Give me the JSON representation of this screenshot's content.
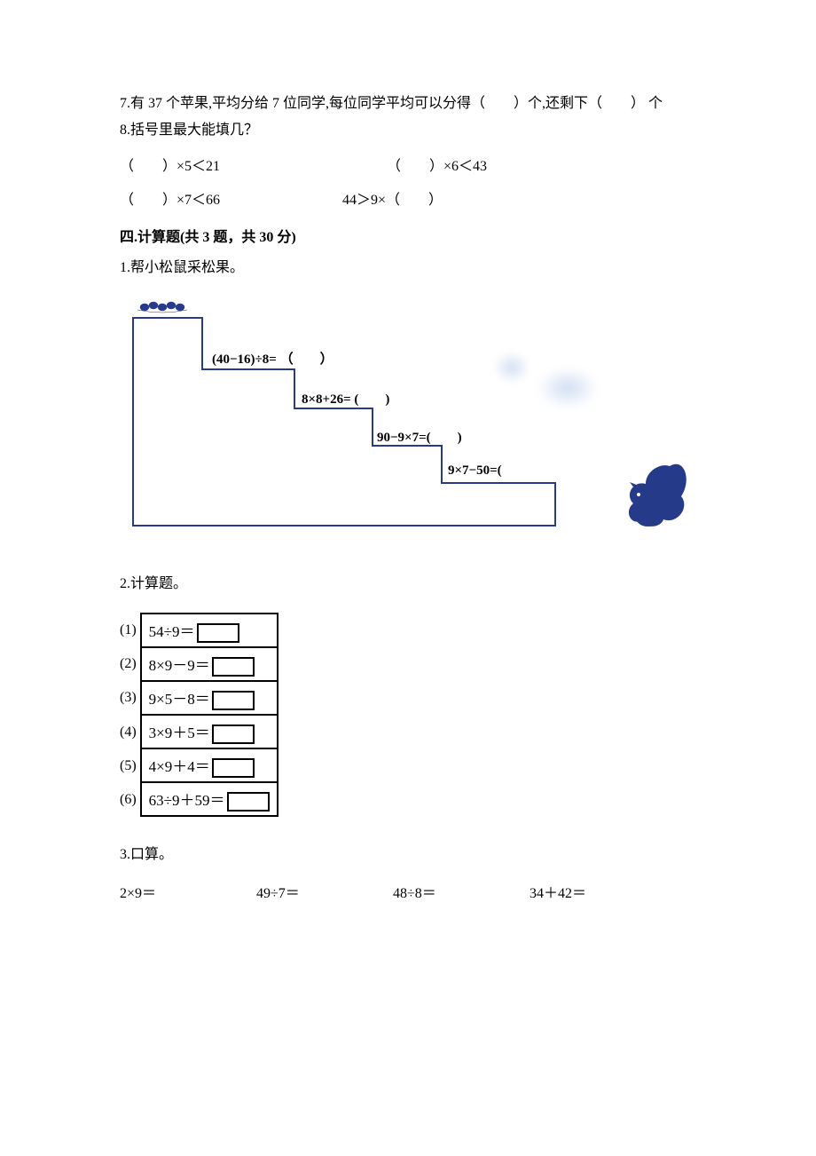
{
  "q7": "7.有 37 个苹果,平均分给 7 位同学,每位同学平均可以分得（　　）个,还剩下（　　） 个",
  "q8_title": "8.括号里最大能填几？",
  "q8_items": {
    "a": "（　　）×5＜21",
    "b": "（　　）×6＜43",
    "c": "（　　）×7＜66",
    "d": "44＞9×（　　）"
  },
  "section4_title": "四.计算题(共 3 题，共 30 分)",
  "q4_1_title": "1.帮小松鼠采松果。",
  "steps": {
    "s1": "(40−16)÷8= （　　）",
    "s2": "8×8+26= (　　)",
    "s3": "90−9×7=(　　)",
    "s4": "9×7−50=("
  },
  "q4_2_title": "2.计算题。",
  "calc_labels": [
    "(1)",
    "(2)",
    "(3)",
    "(4)",
    "(5)",
    "(6)"
  ],
  "calc_exprs": [
    "54÷9＝",
    "8×9－9＝",
    "9×5－8＝",
    "3×9＋5＝",
    "4×9＋4＝",
    "63÷9＋59＝"
  ],
  "q4_3_title": "3.口算。",
  "mental": [
    "2×9＝",
    "49÷7＝",
    "48÷8＝",
    "34＋42＝"
  ]
}
